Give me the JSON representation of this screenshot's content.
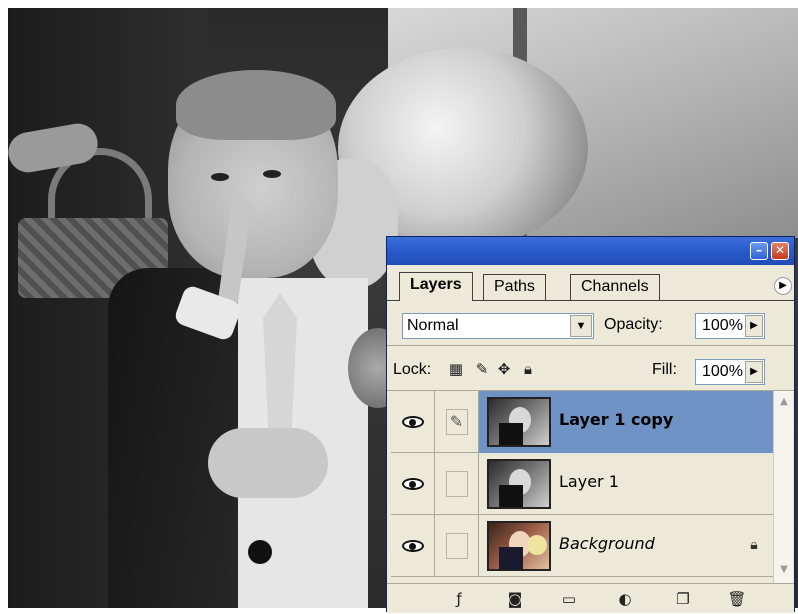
{
  "palette": {
    "tabs": [
      {
        "label": "Layers",
        "active": true
      },
      {
        "label": "Paths",
        "active": false
      },
      {
        "label": "Channels",
        "active": false
      }
    ],
    "blend_mode": "Normal",
    "opacity_label": "Opacity:",
    "opacity_value": "100%",
    "lock_label": "Lock:",
    "fill_label": "Fill:",
    "fill_value": "100%",
    "layers": [
      {
        "name": "Layer 1 copy",
        "selected": true
      },
      {
        "name": "Layer 1",
        "selected": false
      },
      {
        "name": "Background",
        "selected": false,
        "locked": true
      }
    ],
    "footer_icons": [
      "link-layers-icon",
      "add-layer-style-icon",
      "add-mask-icon",
      "new-group-icon",
      "new-adjustment-layer-icon",
      "new-layer-icon",
      "delete-layer-icon"
    ]
  },
  "colors": {
    "titlebar": "#2b5ccc",
    "panel": "#ece9d8",
    "selected_row": "#6f93c4"
  }
}
